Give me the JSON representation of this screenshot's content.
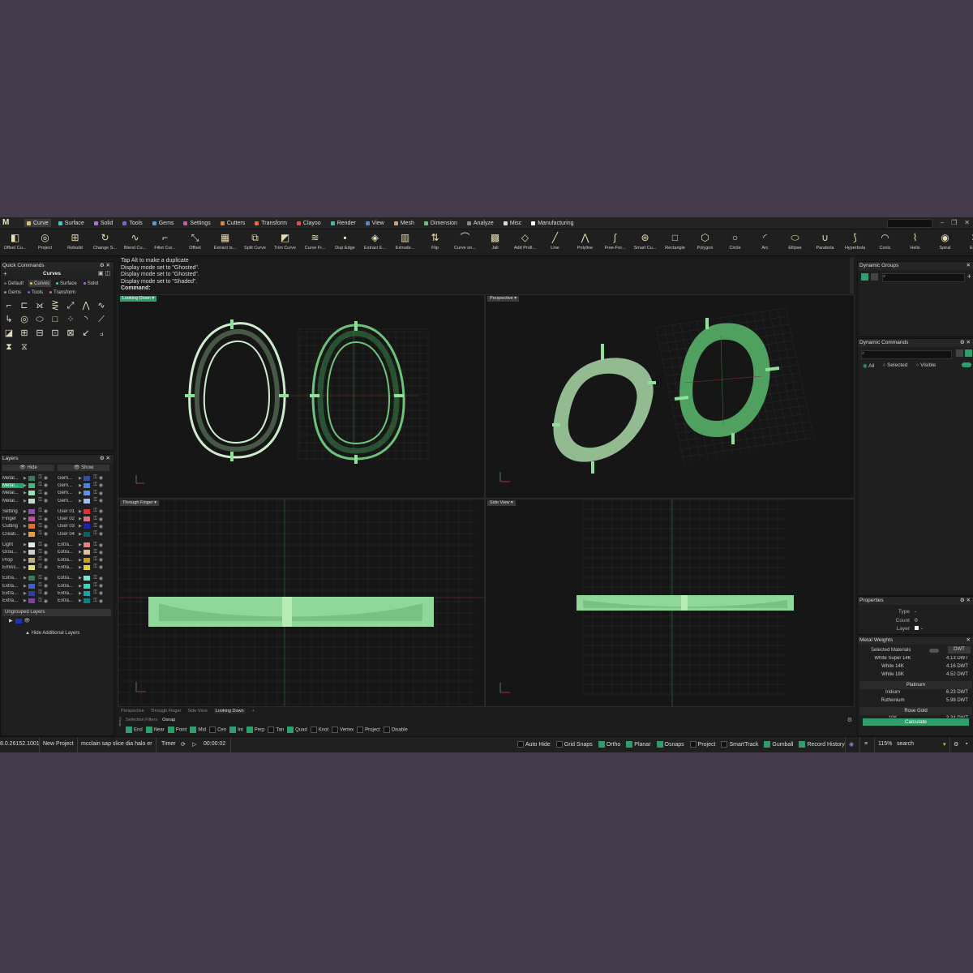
{
  "colors": {
    "accent": "#2e9e6e",
    "bg": "#453a4a",
    "app": "#1b1b1b",
    "ring": "#7ee08e"
  },
  "logo": "M",
  "menus": [
    {
      "label": "Curve",
      "color": "#e6c24a",
      "active": true
    },
    {
      "label": "Surface",
      "color": "#4ac6c6"
    },
    {
      "label": "Solid",
      "color": "#b36ad6"
    },
    {
      "label": "Tools",
      "color": "#6a6ad6"
    },
    {
      "label": "Gems",
      "color": "#5a9ad6"
    },
    {
      "label": "Settings",
      "color": "#c65aa6"
    },
    {
      "label": "Cutters",
      "color": "#d68a4a"
    },
    {
      "label": "Transform",
      "color": "#e06a4a"
    },
    {
      "label": "Clayoo",
      "color": "#e05050"
    },
    {
      "label": "Render",
      "color": "#4ab6a6"
    },
    {
      "label": "View",
      "color": "#4a8ad6"
    },
    {
      "label": "Mesh",
      "color": "#c6a67a"
    },
    {
      "label": "Dimension",
      "color": "#5ac67a"
    },
    {
      "label": "Analyze",
      "color": "#888888"
    },
    {
      "label": "Misc",
      "color": "#dddddd"
    },
    {
      "label": "Manufacturing",
      "color": "#ffffff"
    }
  ],
  "toolbar": [
    {
      "label": "Offset Cu...",
      "icon": "◧"
    },
    {
      "label": "Project",
      "icon": "◎"
    },
    {
      "label": "Rebuild",
      "icon": "⊞"
    },
    {
      "label": "Change S...",
      "icon": "↻"
    },
    {
      "label": "Blend Cu...",
      "icon": "∿"
    },
    {
      "label": "Fillet Cur...",
      "icon": "⌐"
    },
    {
      "label": "Offset",
      "icon": "⤡"
    },
    {
      "label": "Extract Is...",
      "icon": "▦"
    },
    {
      "label": "Split Curve",
      "icon": "⧉"
    },
    {
      "label": "Trim Curve",
      "icon": "◩"
    },
    {
      "label": "Curve Fr...",
      "icon": "≋"
    },
    {
      "label": "Dup Edge",
      "icon": "▪"
    },
    {
      "label": "Extract E...",
      "icon": "◈"
    },
    {
      "label": "Extrude...",
      "icon": "▥"
    },
    {
      "label": "Flip",
      "icon": "⇅"
    },
    {
      "label": "Curve on...",
      "icon": "⌒"
    },
    {
      "label": "Jali",
      "icon": "▩"
    },
    {
      "label": "Add Profi...",
      "icon": "◇"
    },
    {
      "label": "Line",
      "icon": "╱"
    },
    {
      "label": "Polyline",
      "icon": "⋀"
    },
    {
      "label": "Free-For...",
      "icon": "∫"
    },
    {
      "label": "Smart Cu...",
      "icon": "⊛"
    },
    {
      "label": "Rectangle",
      "icon": "□"
    },
    {
      "label": "Polygon",
      "icon": "⬡"
    },
    {
      "label": "Circle",
      "icon": "○"
    },
    {
      "label": "Arc",
      "icon": "◜"
    },
    {
      "label": "Ellipse",
      "icon": "⬭"
    },
    {
      "label": "Parabola",
      "icon": "∪"
    },
    {
      "label": "Hyperbola",
      "icon": "⟆"
    },
    {
      "label": "Conic",
      "icon": "◠"
    },
    {
      "label": "Helix",
      "icon": "⌇"
    },
    {
      "label": "Spiral",
      "icon": "◉"
    },
    {
      "label": "Exter",
      "icon": "✕"
    }
  ],
  "quick": {
    "title": "Quick Commands",
    "section": "Curves",
    "chips": [
      {
        "label": "Default",
        "color": "#666"
      },
      {
        "label": "Curves",
        "color": "#e6c24a",
        "active": true
      },
      {
        "label": "Surface",
        "color": "#4ac6c6"
      },
      {
        "label": "Solid",
        "color": "#b36ad6"
      },
      {
        "label": "Gems",
        "color": "#5a9ad6"
      },
      {
        "label": "Tools",
        "color": "#6a6ad6"
      },
      {
        "label": "Transform",
        "color": "#e06a4a"
      }
    ],
    "icons": [
      "⌐",
      "⊏",
      "⟗",
      "⋛",
      "⤢",
      "⋀",
      "∿",
      "↳",
      "◎",
      "⬭",
      "□",
      "⁘",
      "◝",
      "⟋",
      "◪",
      "⊞",
      "⊟",
      "⊡",
      "⊠",
      "↙",
      "⟓",
      "⧗",
      "⧖"
    ]
  },
  "layers": {
    "title": "Layers",
    "hide": "Hide",
    "show": "Show",
    "left": [
      {
        "name": "Metal...",
        "c": "#3c7a5a"
      },
      {
        "name": "Metal...",
        "c": "#4fb07a",
        "sel": true
      },
      {
        "name": "Metal...",
        "c": "#9be0b0"
      },
      {
        "name": "Metal...",
        "c": "#c8d8c8"
      },
      {
        "gap": true
      },
      {
        "name": "Setting",
        "c": "#9050b0"
      },
      {
        "name": "Finger",
        "c": "#c050a0"
      },
      {
        "name": "Cutting",
        "c": "#e07030"
      },
      {
        "name": "Creati...",
        "c": "#e0a040"
      },
      {
        "gap": true
      },
      {
        "name": "Light",
        "c": "#e8e8e8"
      },
      {
        "name": "Grou...",
        "c": "#d0d0d0"
      },
      {
        "name": "Prop",
        "c": "#c0b080"
      },
      {
        "name": "Emiss...",
        "c": "#e0e070"
      },
      {
        "gap": true
      },
      {
        "name": "Extra...",
        "c": "#3a7a5a"
      },
      {
        "name": "Extra...",
        "c": "#4060c0"
      },
      {
        "name": "Extra...",
        "c": "#304090"
      },
      {
        "name": "Extra...",
        "c": "#8040a0"
      }
    ],
    "right": [
      {
        "name": "Gem...",
        "c": "#3050a0"
      },
      {
        "name": "Gem...",
        "c": "#5080d0"
      },
      {
        "name": "Gem...",
        "c": "#6090e0"
      },
      {
        "name": "Gem...",
        "c": "#a0c0e8"
      },
      {
        "gap": true
      },
      {
        "name": "User 01",
        "c": "#e03030"
      },
      {
        "name": "User 02",
        "c": "#e07080"
      },
      {
        "name": "User 03",
        "c": "#2020c0"
      },
      {
        "name": "User 04",
        "c": "#106060"
      },
      {
        "gap": true
      },
      {
        "name": "Extra...",
        "c": "#e08080"
      },
      {
        "name": "Extra...",
        "c": "#e0c0a0"
      },
      {
        "name": "Extra...",
        "c": "#c0a020"
      },
      {
        "name": "Extra...",
        "c": "#e0d040"
      },
      {
        "gap": true
      },
      {
        "name": "Extra...",
        "c": "#80e0d0"
      },
      {
        "name": "Extra...",
        "c": "#40d0c0"
      },
      {
        "name": "Extra...",
        "c": "#20a0a0"
      },
      {
        "name": "Extra...",
        "c": "#108080"
      }
    ],
    "ungrouped": "Ungrouped Layers",
    "hide_additional": "Hide Additional Layers"
  },
  "history": {
    "lines": [
      "Tap Alt to make a duplicate",
      "Display mode set to \"Ghosted\".",
      "Display mode set to \"Ghosted\".",
      "Display mode set to \"Shaded\"."
    ],
    "command": "Command:"
  },
  "viewports": {
    "top_left": "Looking Down",
    "top_right": "Perspective",
    "bottom_left": "Through Finger",
    "bottom_right": "Side View"
  },
  "bottom_tabs": [
    "Perspective",
    "Through Finger",
    "Side View",
    "Looking Down",
    "+"
  ],
  "filters": {
    "tab1": "Selection Filters",
    "tab2": "Osnap",
    "side": "Osnap"
  },
  "osnaps": [
    {
      "l": "End",
      "on": true
    },
    {
      "l": "Near",
      "on": true
    },
    {
      "l": "Point",
      "on": true
    },
    {
      "l": "Mid",
      "on": true
    },
    {
      "l": "Cen"
    },
    {
      "l": "Int",
      "on": true
    },
    {
      "l": "Perp",
      "on": true
    },
    {
      "l": "Tan"
    },
    {
      "l": "Quad",
      "on": true
    },
    {
      "l": "Knot"
    },
    {
      "l": "Vertex"
    },
    {
      "l": "Project"
    },
    {
      "l": "Disable"
    }
  ],
  "right_panels": {
    "dynamic_groups": "Dynamic Groups",
    "dynamic_commands": "Dynamic Commands",
    "radio_all": "All",
    "radio_selected": "Selected",
    "radio_visible": "Visible",
    "properties": {
      "title": "Properties",
      "type_label": "Type",
      "type_val": "-",
      "count_label": "Count",
      "count_val": "0",
      "layer_label": "Layer",
      "layer_val": "-"
    },
    "metal": {
      "title": "Metal Weights",
      "selected": "Selected Materials",
      "unit": "DWT",
      "rows": [
        {
          "n": "White Super 14K",
          "v": "4.13 DWT"
        },
        {
          "n": "White 14K",
          "v": "4.16 DWT"
        },
        {
          "n": "White 18K",
          "v": "4.52 DWT"
        },
        {
          "head": "Platinum"
        },
        {
          "n": "Iridium",
          "v": "6.23 DWT"
        },
        {
          "n": "Ruthenium",
          "v": "5.98 DWT"
        },
        {
          "head": "Rose Gold"
        },
        {
          "n": "10K",
          "v": "3.34 DWT"
        }
      ],
      "calculate": "Calculate"
    }
  },
  "status": {
    "version": "8.0.26152.1001",
    "project": "New Project",
    "file": "mcclain sap slice dia halo er",
    "timer": "Timer",
    "time": "00:00:02",
    "toggles": [
      {
        "l": "Auto Hide"
      },
      {
        "l": "Grid Snaps"
      },
      {
        "l": "Ortho",
        "on": true
      },
      {
        "l": "Planar",
        "on": true
      },
      {
        "l": "Osnaps",
        "on": true
      },
      {
        "l": "Project"
      },
      {
        "l": "SmartTrack"
      },
      {
        "l": "Gumball",
        "on": true
      },
      {
        "l": "Record History",
        "on": true
      }
    ],
    "zoom": "115%",
    "search": "search"
  }
}
